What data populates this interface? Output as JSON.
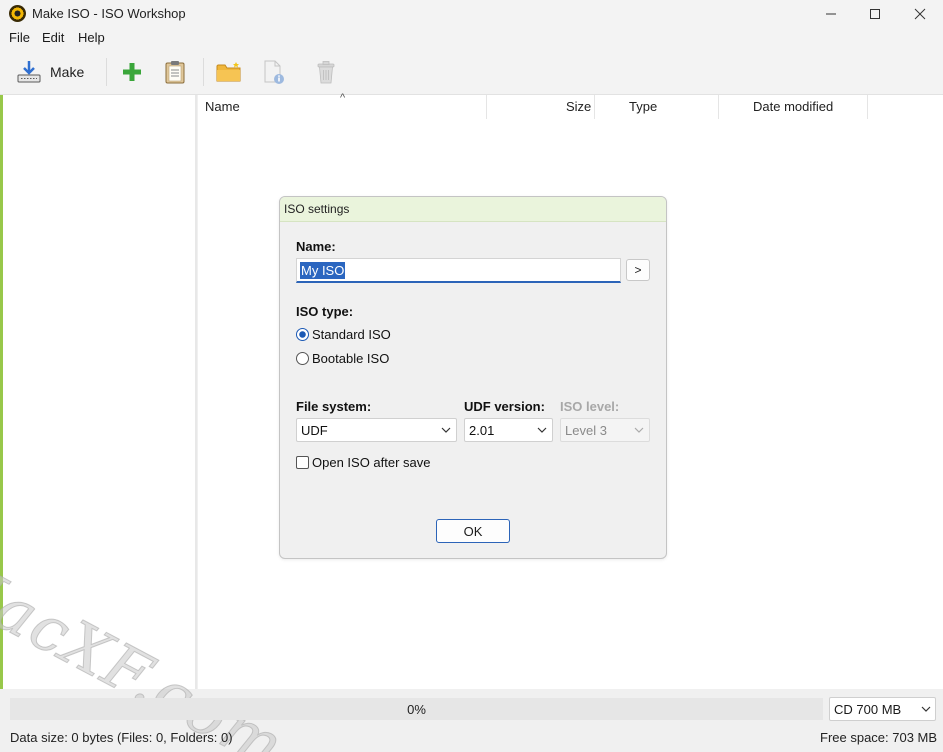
{
  "window": {
    "title": "Make ISO - ISO Workshop",
    "app_icon": "disc-app-icon",
    "controls": [
      "minimize-icon",
      "maximize-icon",
      "close-icon"
    ]
  },
  "menu": {
    "file": "File",
    "edit": "Edit",
    "help": "Help"
  },
  "toolbar": {
    "make_label": "Make",
    "icons": [
      "make-iso-icon",
      "add-icon",
      "clipboard-icon",
      "new-folder-icon",
      "file-properties-icon",
      "trash-icon"
    ]
  },
  "file_list": {
    "columns": {
      "name": "Name",
      "size": "Size",
      "type": "Type",
      "date_modified": "Date modified"
    },
    "sort_indicator": "^"
  },
  "dialog": {
    "title": "ISO settings",
    "name_label": "Name:",
    "name_value": "My ISO",
    "browse_label": ">",
    "iso_type_label": "ISO type:",
    "iso_types": [
      "Standard ISO",
      "Bootable ISO"
    ],
    "selected_iso_type": "Standard ISO",
    "file_system_label": "File system:",
    "file_system_value": "UDF",
    "udf_version_label": "UDF version:",
    "udf_version_value": "2.01",
    "iso_level_label": "ISO level:",
    "iso_level_value": "Level 3",
    "open_after_save_label": "Open ISO after save",
    "open_after_save_checked": false,
    "ok_label": "OK"
  },
  "watermark": "MacXF.com",
  "bottom": {
    "progress_text": "0%",
    "progress": 0,
    "media_value": "CD 700 MB",
    "status_left": "Data size: 0 bytes (Files: 0, Folders: 0)",
    "status_right": "Free space: 703 MB"
  },
  "colors": {
    "accent": "#1b59b5",
    "selection": "#2b66c0",
    "left_border": "#98c84a",
    "dialog_title_bg": "#eaf4dc"
  }
}
